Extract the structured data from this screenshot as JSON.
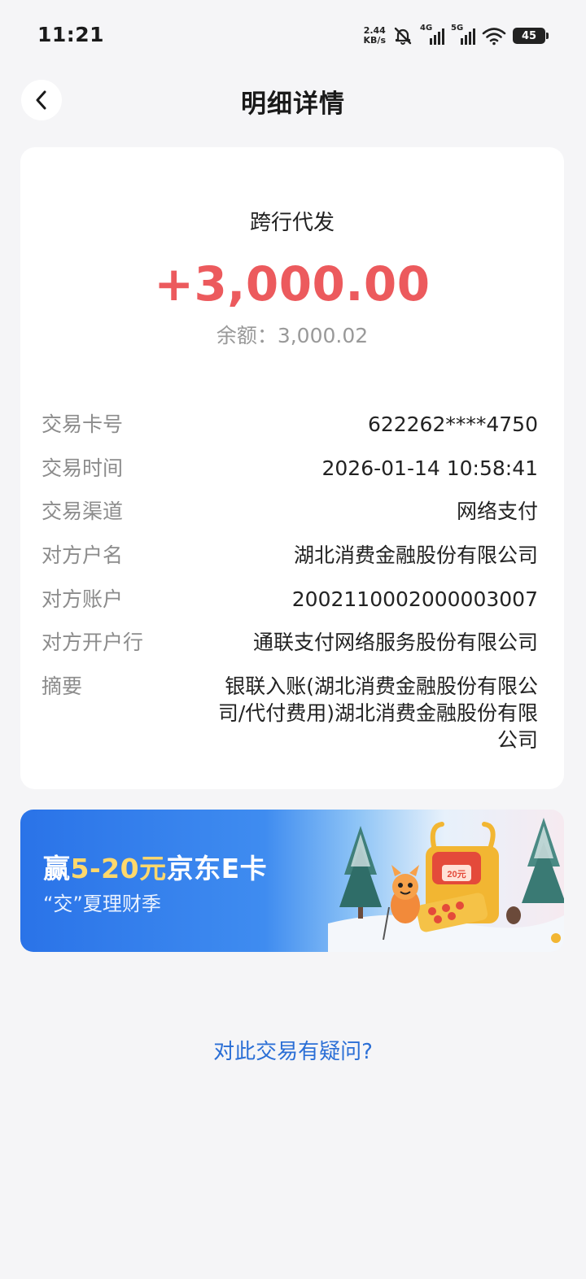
{
  "status_bar": {
    "time": "11:21",
    "net_speed_value": "2.44",
    "net_speed_unit": "KB/s",
    "sim1_tag": "4G",
    "sim2_tag": "5G",
    "battery": "45",
    "icons": [
      "mute-bell-icon",
      "signal-icon",
      "wifi-icon",
      "battery-icon"
    ]
  },
  "nav": {
    "title": "明细详情",
    "back_icon": "chevron-left-icon"
  },
  "transaction": {
    "type": "跨行代发",
    "amount": "+3,000.00",
    "balance_text": "余额：3,000.02",
    "amount_color": "#ec5a5d",
    "fields": [
      {
        "label": "交易卡号",
        "value": "622262****4750"
      },
      {
        "label": "交易时间",
        "value": "2026-01-14 10:58:41"
      },
      {
        "label": "交易渠道",
        "value": "网络支付"
      },
      {
        "label": "对方户名",
        "value": "湖北消费金融股份有限公司"
      },
      {
        "label": "对方账户",
        "value": "2002110002000003007"
      },
      {
        "label": "对方开户行",
        "value": "通联支付网络服务股份有限公司"
      },
      {
        "label": "摘要",
        "value": "银联入账(湖北消费金融股份有限公司/代付费用)湖北消费金融股份有限公司"
      }
    ]
  },
  "promo": {
    "title_prefix": "赢",
    "title_highlight": "5-20元",
    "title_suffix": "京东E卡",
    "subtitle": "“交”夏理财季",
    "badge": "20元"
  },
  "footer": {
    "question_link": "对此交易有疑问?",
    "link_color": "#2b6fd6"
  }
}
